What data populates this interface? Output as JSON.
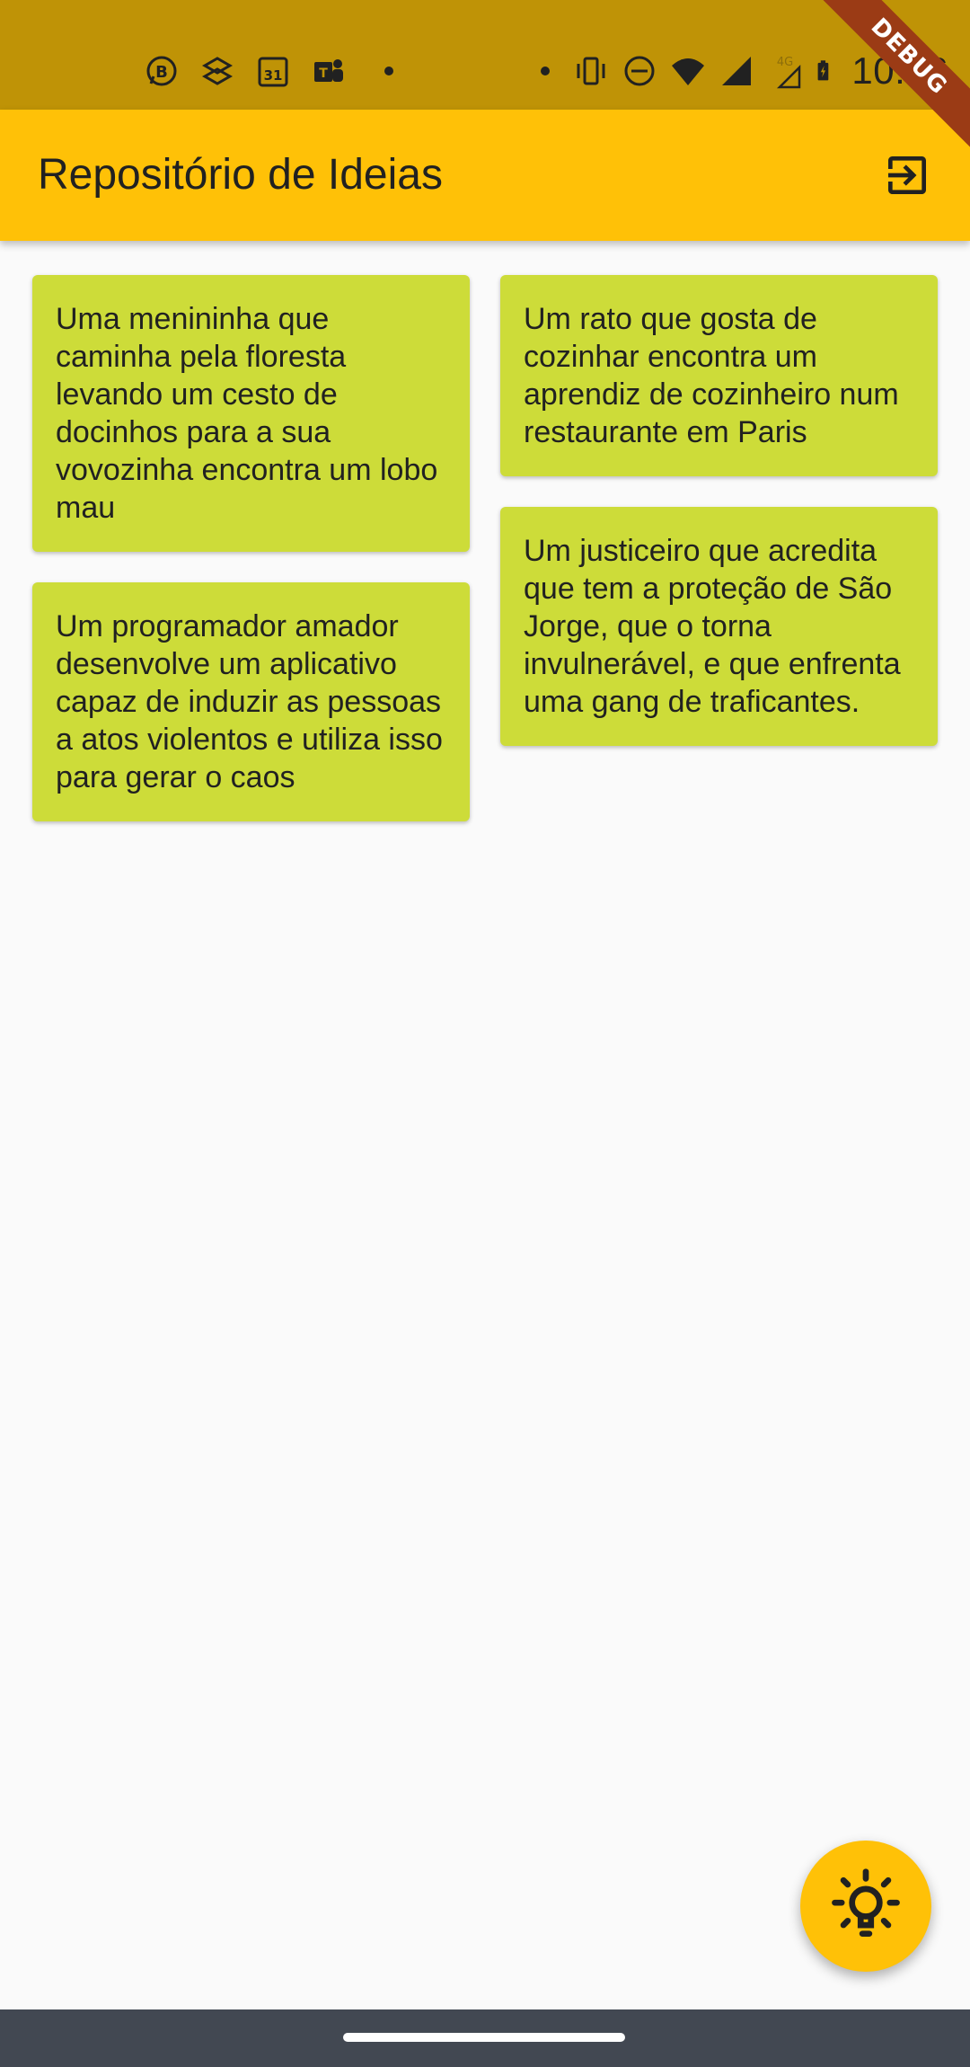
{
  "status_bar": {
    "time": "10:16",
    "left_icons": [
      "whatsapp-business-icon",
      "dropbox-icon",
      "calendar-31-icon",
      "teams-icon"
    ],
    "right_icons": [
      "vibrate-icon",
      "do-not-disturb-icon",
      "wifi-icon",
      "signal-icon",
      "signal-4g-icon",
      "battery-charging-icon"
    ],
    "network_label": "4G"
  },
  "debug_banner": "DEBUG",
  "app_bar": {
    "title": "Repositório de Ideias",
    "action_icon": "logout-icon"
  },
  "ideas": {
    "left": [
      "Uma menininha que caminha pela floresta levando um cesto de docinhos para a sua vovozinha encontra um lobo mau",
      "Um programador amador desenvolve um aplicativo capaz de induzir as pessoas a atos violentos e utiliza isso para gerar o caos"
    ],
    "right": [
      "Um rato que gosta de cozinhar encontra um aprendiz de cozinheiro num restaurante em Paris",
      "Um justiceiro que acredita que tem a proteção de São Jorge, que o torna invulnerável, e que enfrenta uma gang de traficantes."
    ]
  },
  "fab": {
    "icon": "lightbulb-icon"
  },
  "colors": {
    "status_bar": "#bf9306",
    "app_bar": "#ffc107",
    "card": "#cddc39",
    "background": "#fafafa",
    "nav_bar": "#424852",
    "debug_banner": "#9b3b15"
  }
}
